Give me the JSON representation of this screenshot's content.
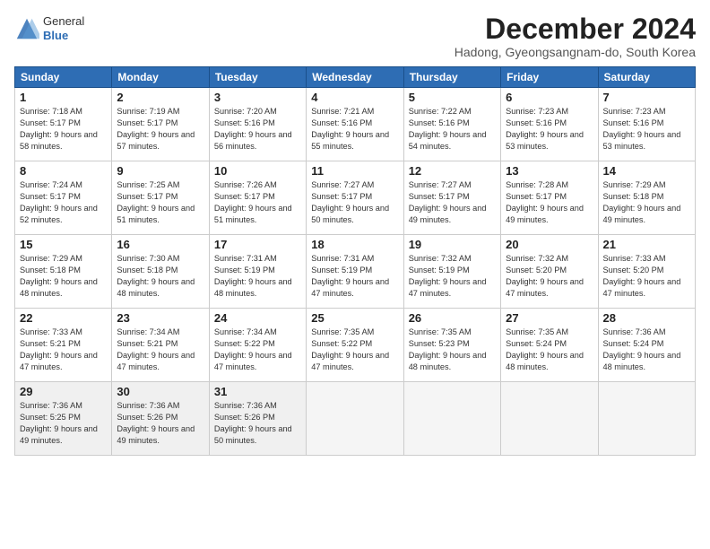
{
  "logo": {
    "general": "General",
    "blue": "Blue"
  },
  "title": "December 2024",
  "location": "Hadong, Gyeongsangnam-do, South Korea",
  "weekdays": [
    "Sunday",
    "Monday",
    "Tuesday",
    "Wednesday",
    "Thursday",
    "Friday",
    "Saturday"
  ],
  "weeks": [
    [
      {
        "day": 1,
        "sunrise": "7:18 AM",
        "sunset": "5:17 PM",
        "daylight": "9 hours and 58 minutes."
      },
      {
        "day": 2,
        "sunrise": "7:19 AM",
        "sunset": "5:17 PM",
        "daylight": "9 hours and 57 minutes."
      },
      {
        "day": 3,
        "sunrise": "7:20 AM",
        "sunset": "5:16 PM",
        "daylight": "9 hours and 56 minutes."
      },
      {
        "day": 4,
        "sunrise": "7:21 AM",
        "sunset": "5:16 PM",
        "daylight": "9 hours and 55 minutes."
      },
      {
        "day": 5,
        "sunrise": "7:22 AM",
        "sunset": "5:16 PM",
        "daylight": "9 hours and 54 minutes."
      },
      {
        "day": 6,
        "sunrise": "7:23 AM",
        "sunset": "5:16 PM",
        "daylight": "9 hours and 53 minutes."
      },
      {
        "day": 7,
        "sunrise": "7:23 AM",
        "sunset": "5:16 PM",
        "daylight": "9 hours and 53 minutes."
      }
    ],
    [
      {
        "day": 8,
        "sunrise": "7:24 AM",
        "sunset": "5:17 PM",
        "daylight": "9 hours and 52 minutes."
      },
      {
        "day": 9,
        "sunrise": "7:25 AM",
        "sunset": "5:17 PM",
        "daylight": "9 hours and 51 minutes."
      },
      {
        "day": 10,
        "sunrise": "7:26 AM",
        "sunset": "5:17 PM",
        "daylight": "9 hours and 51 minutes."
      },
      {
        "day": 11,
        "sunrise": "7:27 AM",
        "sunset": "5:17 PM",
        "daylight": "9 hours and 50 minutes."
      },
      {
        "day": 12,
        "sunrise": "7:27 AM",
        "sunset": "5:17 PM",
        "daylight": "9 hours and 49 minutes."
      },
      {
        "day": 13,
        "sunrise": "7:28 AM",
        "sunset": "5:17 PM",
        "daylight": "9 hours and 49 minutes."
      },
      {
        "day": 14,
        "sunrise": "7:29 AM",
        "sunset": "5:18 PM",
        "daylight": "9 hours and 49 minutes."
      }
    ],
    [
      {
        "day": 15,
        "sunrise": "7:29 AM",
        "sunset": "5:18 PM",
        "daylight": "9 hours and 48 minutes."
      },
      {
        "day": 16,
        "sunrise": "7:30 AM",
        "sunset": "5:18 PM",
        "daylight": "9 hours and 48 minutes."
      },
      {
        "day": 17,
        "sunrise": "7:31 AM",
        "sunset": "5:19 PM",
        "daylight": "9 hours and 48 minutes."
      },
      {
        "day": 18,
        "sunrise": "7:31 AM",
        "sunset": "5:19 PM",
        "daylight": "9 hours and 47 minutes."
      },
      {
        "day": 19,
        "sunrise": "7:32 AM",
        "sunset": "5:19 PM",
        "daylight": "9 hours and 47 minutes."
      },
      {
        "day": 20,
        "sunrise": "7:32 AM",
        "sunset": "5:20 PM",
        "daylight": "9 hours and 47 minutes."
      },
      {
        "day": 21,
        "sunrise": "7:33 AM",
        "sunset": "5:20 PM",
        "daylight": "9 hours and 47 minutes."
      }
    ],
    [
      {
        "day": 22,
        "sunrise": "7:33 AM",
        "sunset": "5:21 PM",
        "daylight": "9 hours and 47 minutes."
      },
      {
        "day": 23,
        "sunrise": "7:34 AM",
        "sunset": "5:21 PM",
        "daylight": "9 hours and 47 minutes."
      },
      {
        "day": 24,
        "sunrise": "7:34 AM",
        "sunset": "5:22 PM",
        "daylight": "9 hours and 47 minutes."
      },
      {
        "day": 25,
        "sunrise": "7:35 AM",
        "sunset": "5:22 PM",
        "daylight": "9 hours and 47 minutes."
      },
      {
        "day": 26,
        "sunrise": "7:35 AM",
        "sunset": "5:23 PM",
        "daylight": "9 hours and 48 minutes."
      },
      {
        "day": 27,
        "sunrise": "7:35 AM",
        "sunset": "5:24 PM",
        "daylight": "9 hours and 48 minutes."
      },
      {
        "day": 28,
        "sunrise": "7:36 AM",
        "sunset": "5:24 PM",
        "daylight": "9 hours and 48 minutes."
      }
    ],
    [
      {
        "day": 29,
        "sunrise": "7:36 AM",
        "sunset": "5:25 PM",
        "daylight": "9 hours and 49 minutes."
      },
      {
        "day": 30,
        "sunrise": "7:36 AM",
        "sunset": "5:26 PM",
        "daylight": "9 hours and 49 minutes."
      },
      {
        "day": 31,
        "sunrise": "7:36 AM",
        "sunset": "5:26 PM",
        "daylight": "9 hours and 50 minutes."
      },
      null,
      null,
      null,
      null
    ]
  ]
}
